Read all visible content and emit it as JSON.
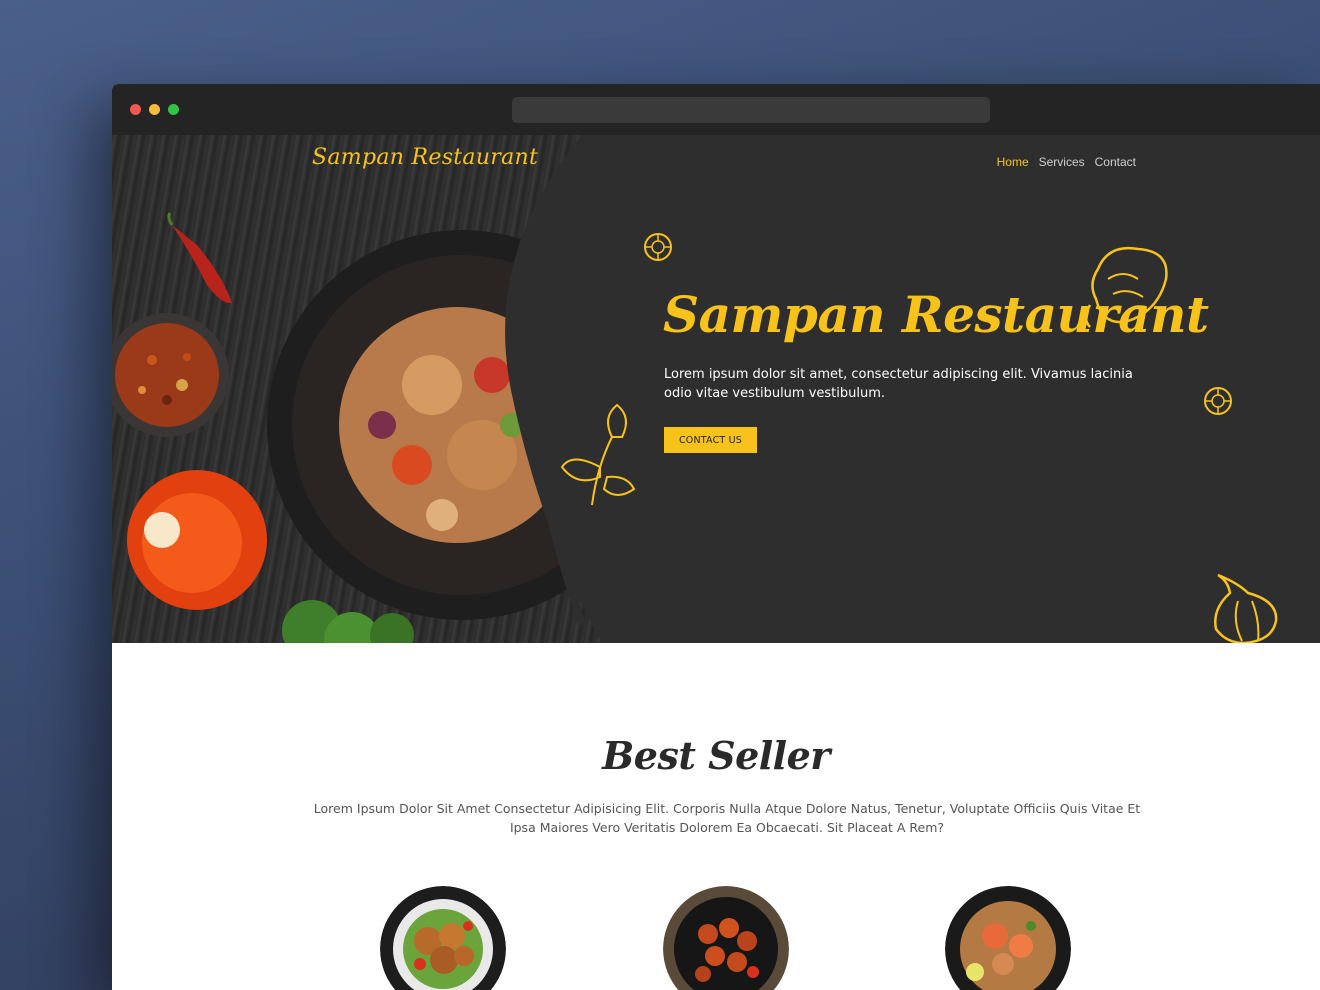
{
  "browser": {
    "url": ""
  },
  "nav": {
    "logo": "Sampan Restaurant",
    "links": [
      "Home",
      "Services",
      "Contact"
    ]
  },
  "hero": {
    "title": "Sampan Restaurant",
    "text": "Lorem ipsum dolor sit amet, consectetur adipiscing elit. Vivamus lacinia odio vitae vestibulum vestibulum.",
    "cta": "CONTACT US"
  },
  "bestseller": {
    "title": "Best Seller",
    "text": "Lorem Ipsum Dolor Sit Amet Consectetur Adipisicing Elit. Corporis Nulla Atque Dolore Natus, Tenetur, Voluptate Officiis Quis Vitae Et Ipsa Maiores Vero Veritatis Dolorem Ea Obcaecati. Sit Placeat A Rem?"
  },
  "colors": {
    "accent": "#f7c31a",
    "hero_bg": "#2e2e2e",
    "titlebar": "#242424"
  }
}
